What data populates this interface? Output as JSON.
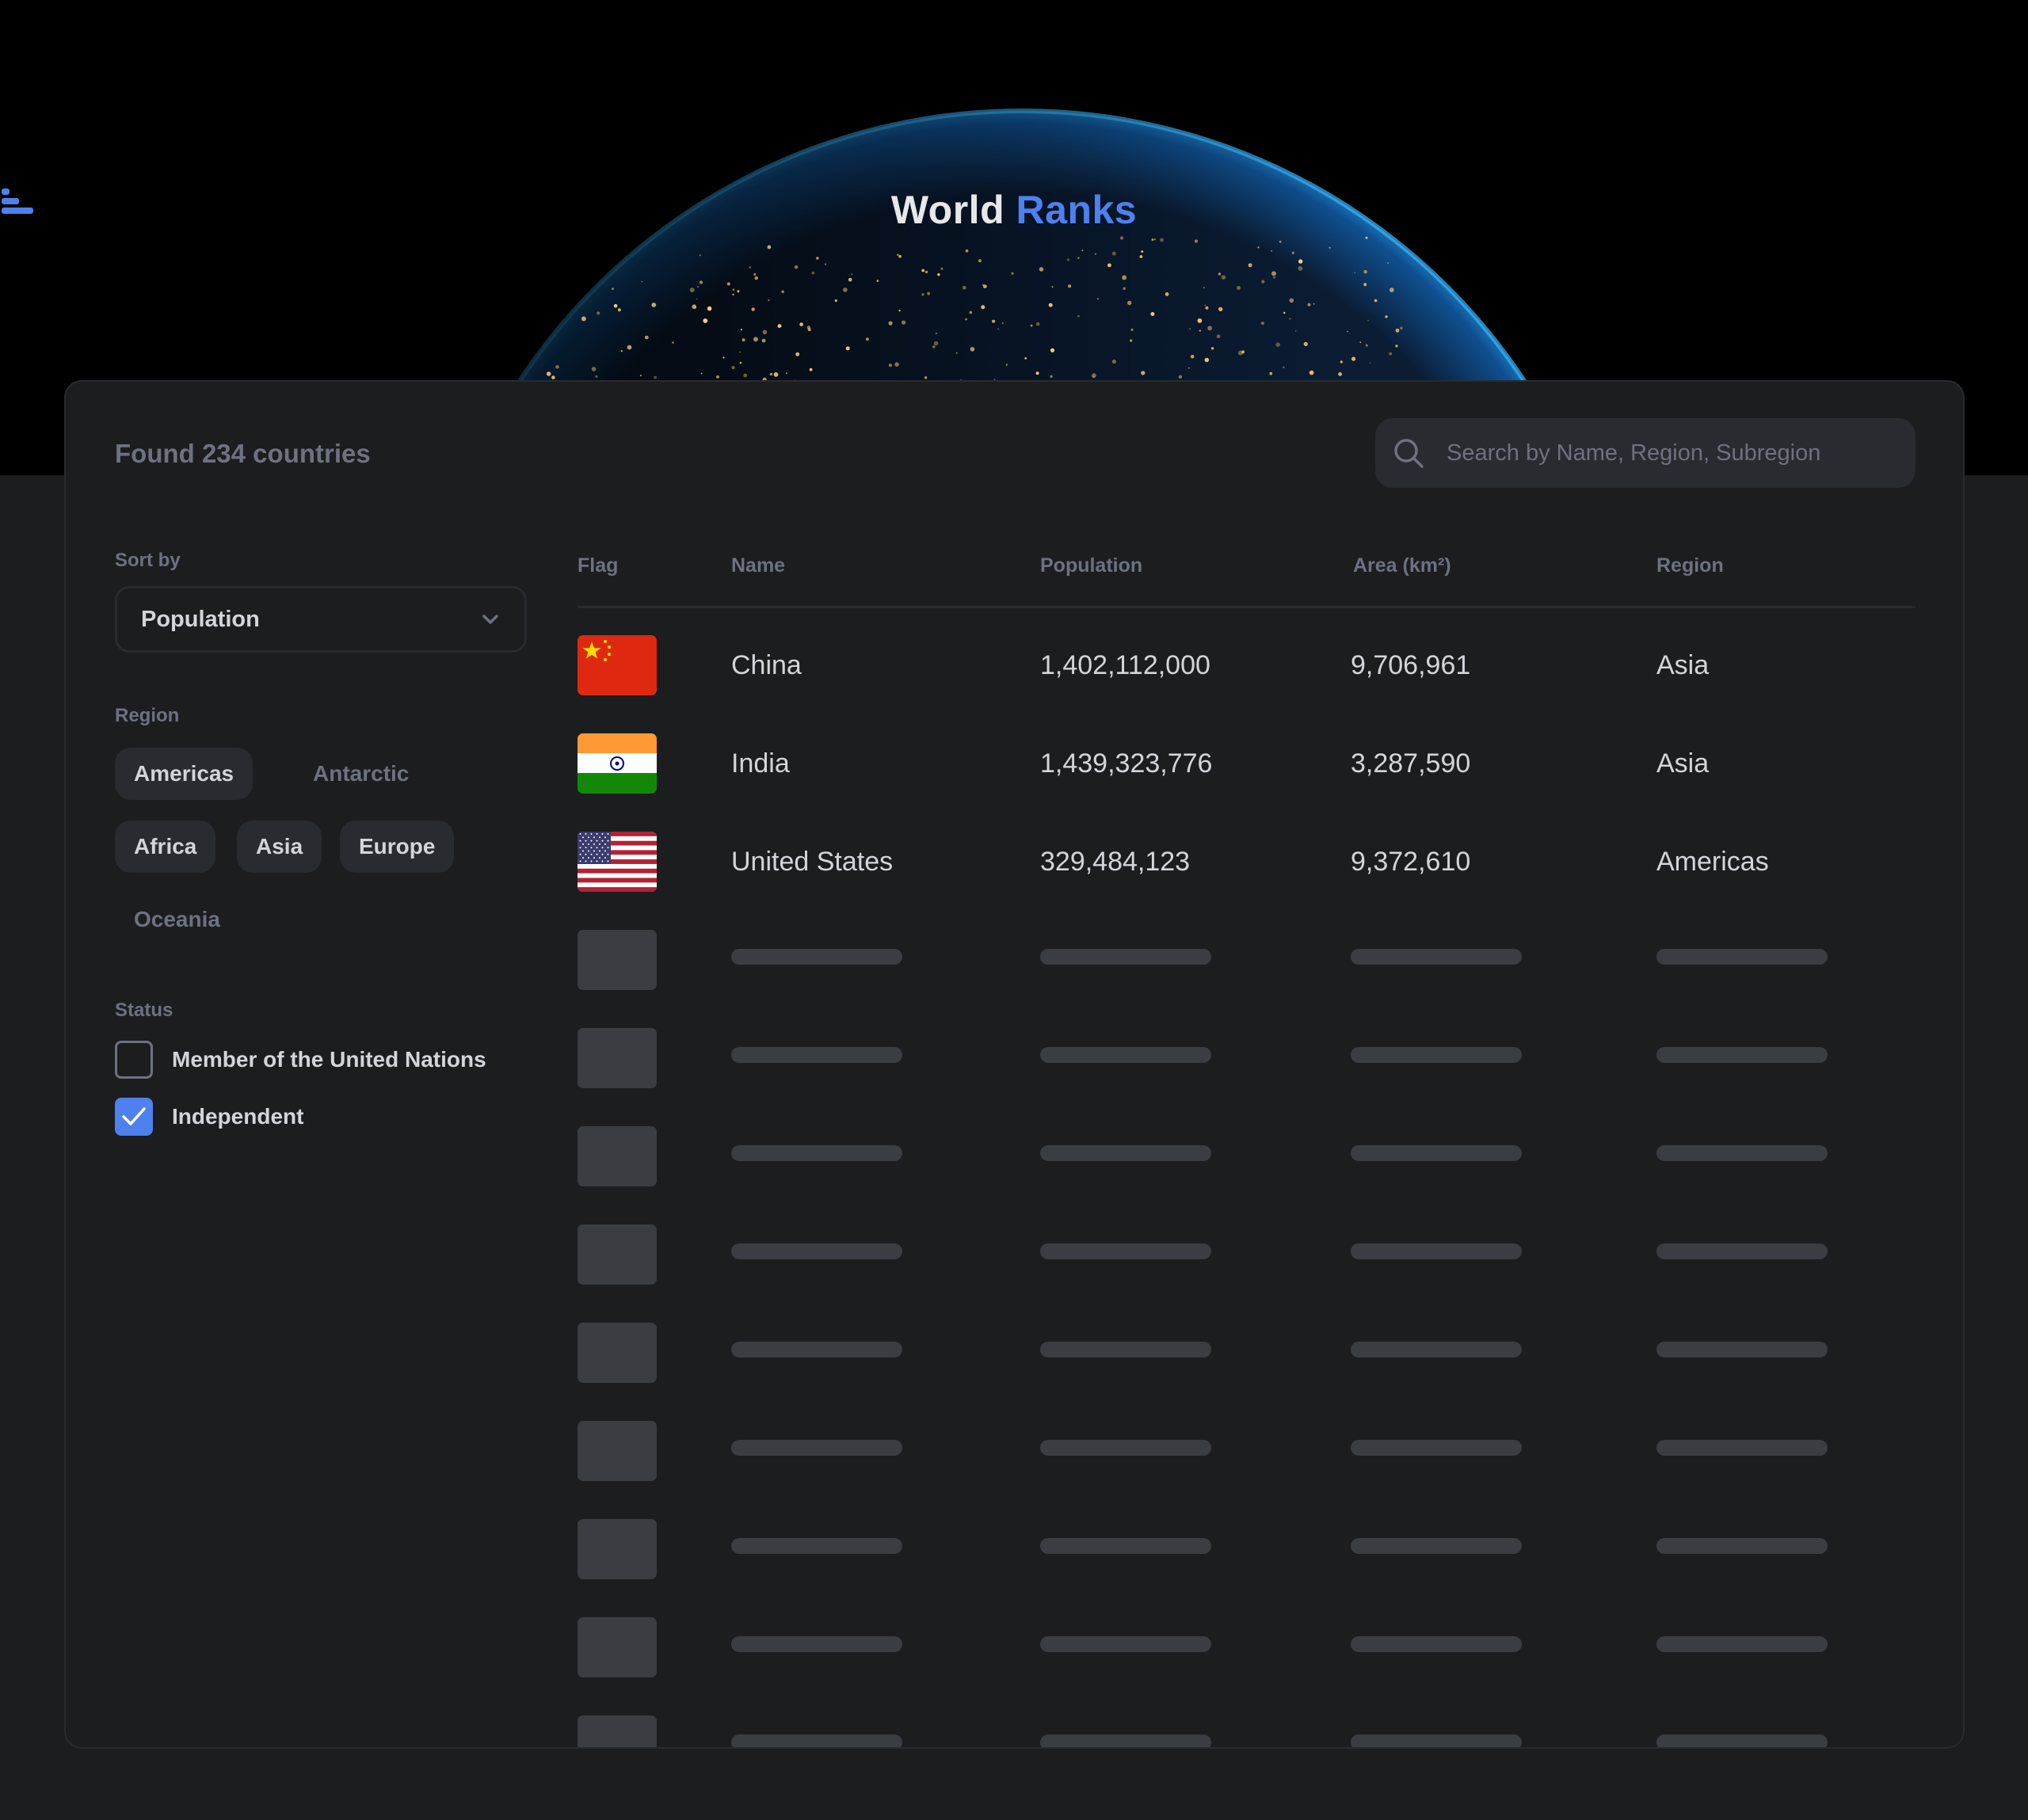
{
  "header": {
    "title_part1": "World",
    "title_part2": "Ranks",
    "logo_icon": "bars-icon",
    "accent_color": "#4e80ee"
  },
  "summary": {
    "found_text": "Found 234 countries"
  },
  "search": {
    "placeholder": "Search by Name, Region, Subregion",
    "icon": "search-icon"
  },
  "sidebar": {
    "sort_label": "Sort by",
    "sort_value": "Population",
    "region_label": "Region",
    "regions": [
      {
        "label": "Americas",
        "selected": true
      },
      {
        "label": "Antarctic",
        "selected": false
      },
      {
        "label": "Africa",
        "selected": true
      },
      {
        "label": "Asia",
        "selected": true
      },
      {
        "label": "Europe",
        "selected": true
      },
      {
        "label": "Oceania",
        "selected": false
      }
    ],
    "status_label": "Status",
    "statuses": [
      {
        "label": "Member of the United Nations",
        "checked": false
      },
      {
        "label": "Independent",
        "checked": true
      }
    ]
  },
  "table": {
    "columns": [
      "Flag",
      "Name",
      "Population",
      "Area (km²)",
      "Region"
    ],
    "rows": [
      {
        "flag": "china-flag-icon",
        "name": "China",
        "population": "1,402,112,000",
        "area": "9,706,961",
        "region": "Asia"
      },
      {
        "flag": "india-flag-icon",
        "name": "India",
        "population": "1,439,323,776",
        "area": "3,287,590",
        "region": "Asia"
      },
      {
        "flag": "usa-flag-icon",
        "name": "United States",
        "population": "329,484,123",
        "area": "9,372,610",
        "region": "Americas"
      }
    ],
    "skeleton_rows": 9
  }
}
